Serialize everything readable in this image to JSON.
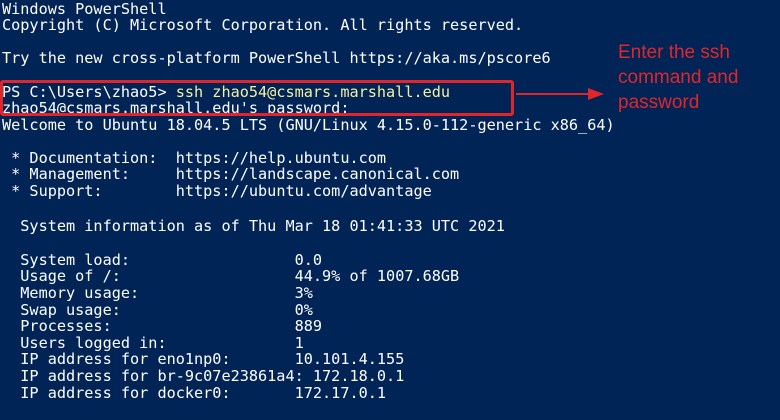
{
  "header": {
    "title_line": "Windows PowerShell",
    "copyright_line": "Copyright (C) Microsoft Corporation. All rights reserved.",
    "try_line": "Try the new cross-platform PowerShell https://aka.ms/pscore6"
  },
  "command": {
    "prompt": "PS C:\\Users\\zhao5> ",
    "command_text": "ssh zhao54@csmars.marshall.edu",
    "password_prompt": "zhao54@csmars.marshall.edu's password:"
  },
  "welcome": {
    "line": "Welcome to Ubuntu 18.04.5 LTS (GNU/Linux 4.15.0-112-generic x86_64)",
    "links": [
      {
        "label": " * Documentation:  ",
        "url": "https://help.ubuntu.com"
      },
      {
        "label": " * Management:     ",
        "url": "https://landscape.canonical.com"
      },
      {
        "label": " * Support:        ",
        "url": "https://ubuntu.com/advantage"
      }
    ]
  },
  "sysinfo": {
    "heading": "  System information as of Thu Mar 18 01:41:33 UTC 2021",
    "rows": [
      {
        "label": "  System load:                  ",
        "value": "0.0"
      },
      {
        "label": "  Usage of /:                   ",
        "value": "44.9% of 1007.68GB"
      },
      {
        "label": "  Memory usage:                 ",
        "value": "3%"
      },
      {
        "label": "  Swap usage:                   ",
        "value": "0%"
      },
      {
        "label": "  Processes:                    ",
        "value": "889"
      },
      {
        "label": "  Users logged in:              ",
        "value": "1"
      },
      {
        "label": "  IP address for eno1np0:       ",
        "value": "10.101.4.155"
      },
      {
        "label": "  IP address for br-9c07e23861a4: ",
        "value": "172.18.0.1"
      },
      {
        "label": "  IP address for docker0:       ",
        "value": "172.17.0.1"
      }
    ]
  },
  "annotation": {
    "lines": [
      "Enter the ssh",
      "command and",
      "password"
    ],
    "color": "#e0262b"
  },
  "colors": {
    "background": "#012456",
    "text": "#ffffff",
    "command": "#f5f0a0"
  }
}
